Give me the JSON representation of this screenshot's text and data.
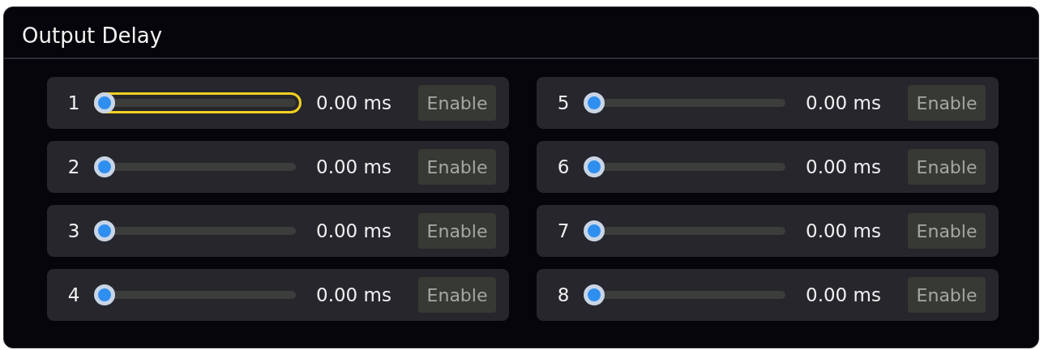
{
  "panel": {
    "title": "Output Delay"
  },
  "channels": [
    {
      "label": "1",
      "level": 0,
      "reading": "0.00 ms",
      "button": "Enable",
      "focused": true
    },
    {
      "label": "2",
      "level": 0,
      "reading": "0.00 ms",
      "button": "Enable",
      "focused": false
    },
    {
      "label": "3",
      "level": 0,
      "reading": "0.00 ms",
      "button": "Enable",
      "focused": false
    },
    {
      "label": "4",
      "level": 0,
      "reading": "0.00 ms",
      "button": "Enable",
      "focused": false
    },
    {
      "label": "5",
      "level": 0,
      "reading": "0.00 ms",
      "button": "Enable",
      "focused": false
    },
    {
      "label": "6",
      "level": 0,
      "reading": "0.00 ms",
      "button": "Enable",
      "focused": false
    },
    {
      "label": "7",
      "level": 0,
      "reading": "0.00 ms",
      "button": "Enable",
      "focused": false
    },
    {
      "label": "8",
      "level": 0,
      "reading": "0.00 ms",
      "button": "Enable",
      "focused": false
    }
  ]
}
